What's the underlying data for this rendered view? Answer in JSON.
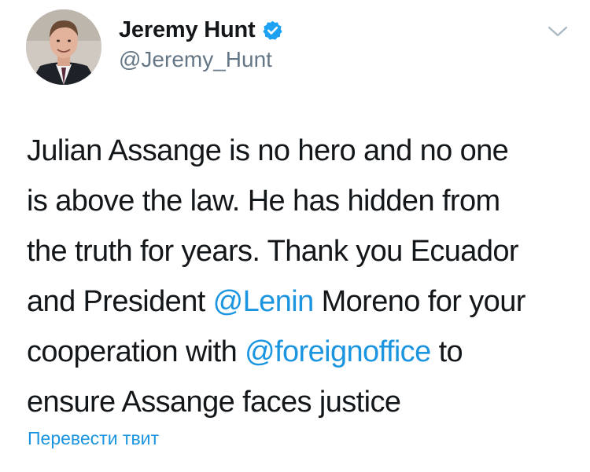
{
  "author": {
    "display_name": "Jeremy Hunt",
    "handle": "@Jeremy_Hunt",
    "verified": true,
    "avatar_icon": "profile-photo"
  },
  "tweet": {
    "lines": [
      {
        "parts": [
          {
            "text": "Julian Assange is no hero and no one",
            "type": "text"
          }
        ]
      },
      {
        "parts": [
          {
            "text": "is above the law. He has hidden from",
            "type": "text"
          }
        ]
      },
      {
        "parts": [
          {
            "text": "the truth for years. Thank you Ecuador",
            "type": "text"
          }
        ]
      },
      {
        "parts": [
          {
            "text": "and President ",
            "type": "text"
          },
          {
            "text": "@Lenin",
            "type": "mention"
          },
          {
            "text": " Moreno for your",
            "type": "text"
          }
        ]
      },
      {
        "parts": [
          {
            "text": "cooperation with ",
            "type": "text"
          },
          {
            "text": "@foreignoffice",
            "type": "mention"
          },
          {
            "text": " to",
            "type": "text"
          }
        ]
      },
      {
        "parts": [
          {
            "text": "ensure Assange faces justice",
            "type": "text"
          }
        ]
      }
    ]
  },
  "translate_label": "Перевести твит",
  "colors": {
    "link": "#1b95e0",
    "text": "#14171a",
    "secondary": "#657786",
    "verified_badge": "#1da1f2"
  },
  "icons": {
    "verified": "verified-badge-icon",
    "menu": "chevron-down-icon"
  }
}
